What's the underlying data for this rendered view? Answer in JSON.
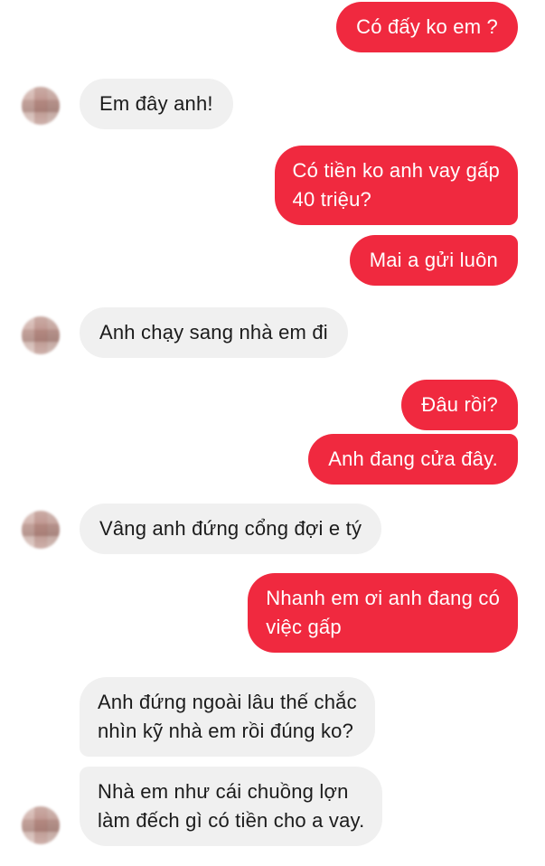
{
  "conversation": {
    "messages": [
      {
        "side": "sent",
        "text": "Có đấy ko em ?"
      },
      {
        "side": "received",
        "text": "Em đây anh!"
      },
      {
        "side": "sent",
        "text": "Có tiền ko anh vay gấp\n40 triệu?"
      },
      {
        "side": "sent",
        "text": "Mai a gửi luôn"
      },
      {
        "side": "received",
        "text": "Anh chạy sang nhà em đi"
      },
      {
        "side": "sent",
        "text": "Đâu rồi?"
      },
      {
        "side": "sent",
        "text": "Anh đang cửa đây."
      },
      {
        "side": "received",
        "text": "Vâng anh đứng cổng đợi e tý"
      },
      {
        "side": "sent",
        "text": "Nhanh em ơi anh đang có\nviệc gấp"
      },
      {
        "side": "received",
        "text": "Anh đứng ngoài lâu thế chắc\nnhìn kỹ nhà em rồi đúng ko?"
      },
      {
        "side": "received",
        "text": "Nhà em như cái chuồng lợn\nlàm đếch gì có tiền cho a vay."
      }
    ]
  },
  "colors": {
    "sent_bubble": "#f0293f",
    "sent_text": "#ffffff",
    "received_bubble": "#f0f0f0",
    "received_text": "#1b1b1b"
  }
}
